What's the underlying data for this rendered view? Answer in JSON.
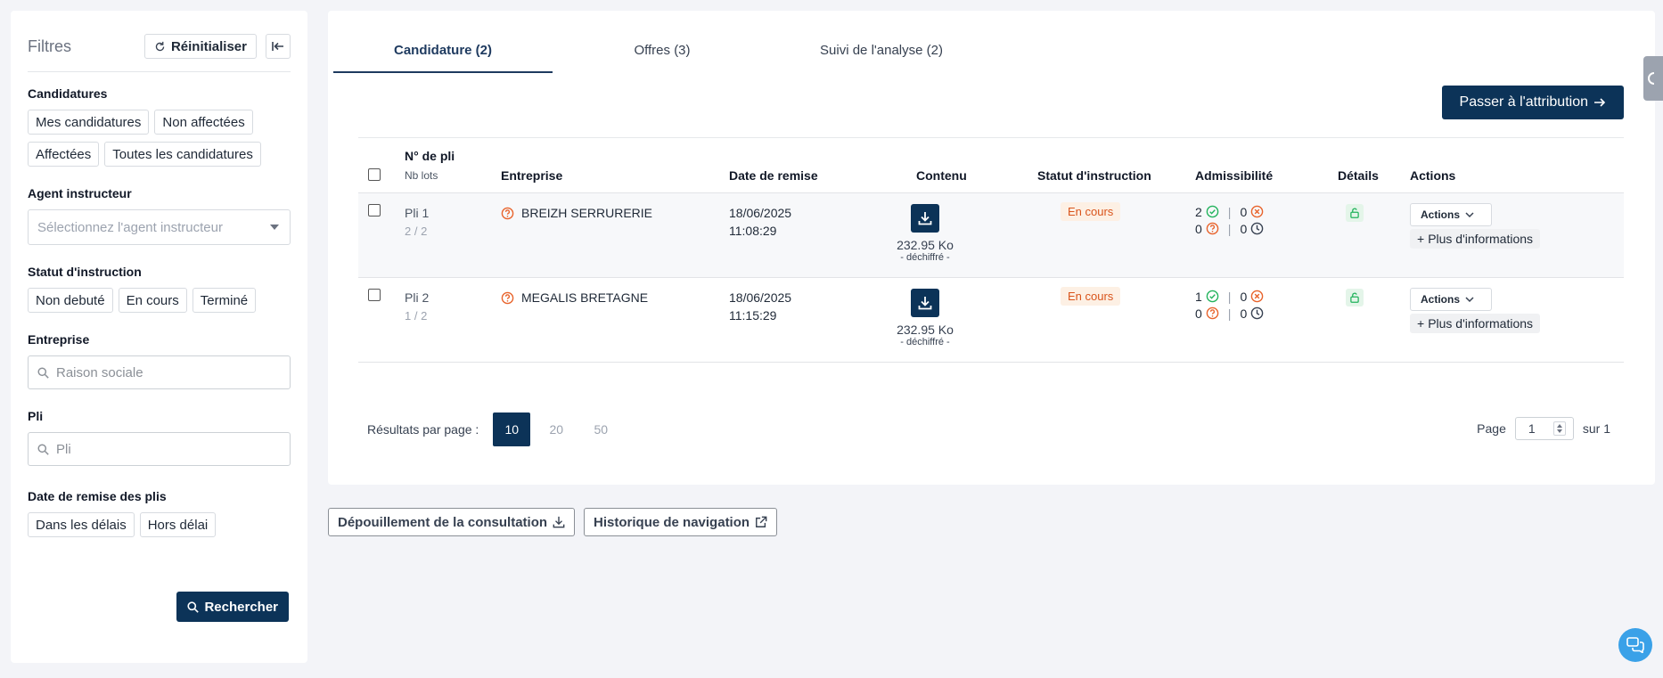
{
  "sidebar": {
    "title": "Filtres",
    "reset_label": "Réinitialiser",
    "candidatures": {
      "label": "Candidatures",
      "chips": [
        "Mes candidatures",
        "Non affectées",
        "Affectées",
        "Toutes les candidatures"
      ]
    },
    "agent": {
      "label": "Agent instructeur",
      "placeholder": "Sélectionnez l'agent instructeur"
    },
    "statut": {
      "label": "Statut d'instruction",
      "chips": [
        "Non debuté",
        "En cours",
        "Terminé"
      ]
    },
    "entreprise": {
      "label": "Entreprise",
      "placeholder": "Raison sociale"
    },
    "pli": {
      "label": "Pli",
      "placeholder": "Pli"
    },
    "date": {
      "label": "Date de remise des plis",
      "chips": [
        "Dans les délais",
        "Hors délai"
      ]
    },
    "search_label": "Rechercher"
  },
  "main": {
    "tabs": [
      "Candidature (2)",
      "Offres (3)",
      "Suivi de l'analyse (2)"
    ],
    "attribution_label": "Passer à l'attribution",
    "table": {
      "headers": {
        "pli": "N° de pli",
        "nb_lots": "Nb lots",
        "entreprise": "Entreprise",
        "date": "Date de remise",
        "contenu": "Contenu",
        "statut": "Statut d'instruction",
        "admissibilite": "Admissibilité",
        "details": "Détails",
        "actions": "Actions"
      },
      "rows": [
        {
          "pli": "Pli 1",
          "lots": "2 / 2",
          "entreprise": "BREIZH SERRURERIE",
          "date": "18/06/2025",
          "time": "11:08:29",
          "size": "232.95 Ko",
          "state": "- déchiffré -",
          "statut": "En cours",
          "adm_ok": "2",
          "adm_ko": "0",
          "adm_q": "0",
          "adm_wait": "0",
          "actions_label": "Actions",
          "more_label": "Plus d'informations"
        },
        {
          "pli": "Pli 2",
          "lots": "1 / 2",
          "entreprise": "MEGALIS BRETAGNE",
          "date": "18/06/2025",
          "time": "11:15:29",
          "size": "232.95 Ko",
          "state": "- déchiffré -",
          "statut": "En cours",
          "adm_ok": "1",
          "adm_ko": "0",
          "adm_q": "0",
          "adm_wait": "0",
          "actions_label": "Actions",
          "more_label": "Plus d'informations"
        }
      ]
    },
    "pagination": {
      "results_label": "Résultats par page :",
      "sizes": [
        "10",
        "20",
        "50"
      ],
      "page_label": "Page",
      "page_value": "1",
      "of_label": "sur 1"
    }
  },
  "bottom": {
    "depouillement_label": "Dépouillement de la consultation",
    "historique_label": "Historique de navigation"
  },
  "colors": {
    "primary": "#0c3358",
    "warning": "#e8632b",
    "success": "#22b35c"
  }
}
